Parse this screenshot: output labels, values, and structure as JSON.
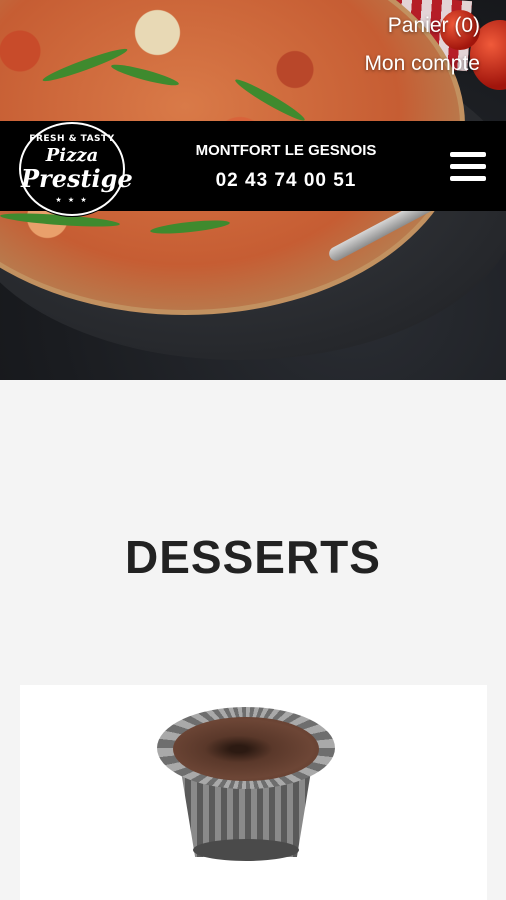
{
  "header": {
    "cart_label": "Panier (0)",
    "account_label": "Mon compte",
    "town": "MONTFORT LE GESNOIS",
    "phone": "02 43 74 00 51"
  },
  "logo": {
    "top_text": "FRESH & TASTY",
    "line1": "Pizza",
    "line2": "Prestige",
    "stars": "★ ★ ★"
  },
  "main": {
    "section_title": "DESSERTS"
  },
  "products": [
    {
      "image_icon": "chocolate-lava-cake-photo"
    }
  ],
  "colors": {
    "header_bg": "#000000",
    "page_bg": "#f4f4f4",
    "title_text": "#222222"
  }
}
